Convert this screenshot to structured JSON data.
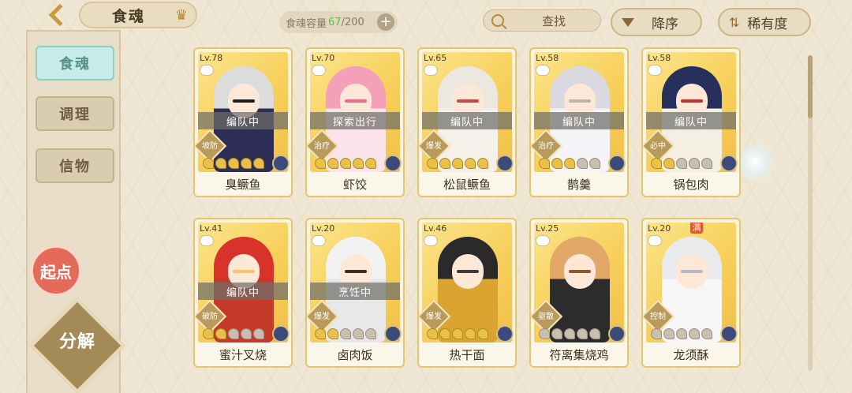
{
  "header": {
    "title": "食魂",
    "capacity_label": "食魂容量",
    "capacity_current": "67",
    "capacity_total": "/200",
    "capacity_plus": "+",
    "search_label": "查找",
    "sort_label": "降序",
    "rarity_label": "稀有度",
    "rarity_symbol": "⇅"
  },
  "sidebar": {
    "tabs": [
      {
        "label": "食魂"
      },
      {
        "label": "调理"
      },
      {
        "label": "信物"
      }
    ],
    "start_label": "起点",
    "decompose_label": "分解"
  },
  "cards": [
    {
      "lv": "Lv.78",
      "status": "编队中",
      "role": "坡防",
      "name": "臭鳜鱼",
      "stars": 5,
      "lit": 5,
      "hair": "#dcdcdc",
      "cloth": "#2d2d56",
      "accent": "#1c1c1c"
    },
    {
      "lv": "Lv.70",
      "status": "探索出行",
      "role": "治疗",
      "name": "虾饺",
      "stars": 5,
      "lit": 5,
      "hair": "#f4a0b8",
      "cloth": "#fbe3ea",
      "accent": "#e86b8a"
    },
    {
      "lv": "Lv.65",
      "status": "编队中",
      "role": "爆发",
      "name": "松鼠鳜鱼",
      "stars": 5,
      "lit": 5,
      "hair": "#ece8e0",
      "cloth": "#f5f1ea",
      "accent": "#c44a4a"
    },
    {
      "lv": "Lv.58",
      "status": "编队中",
      "role": "治疗",
      "name": "鹊羹",
      "stars": 5,
      "lit": 3,
      "hair": "#d9d9df",
      "cloth": "#f4f4f8",
      "accent": "#bdb6a0"
    },
    {
      "lv": "Lv.58",
      "status": "编队中",
      "role": "必中",
      "name": "锅包肉",
      "stars": 5,
      "lit": 2,
      "hair": "#26305a",
      "cloth": "#f4efe3",
      "accent": "#b8322a"
    },
    {
      "lv": "Lv.41",
      "status": "编队中",
      "role": "破防",
      "name": "蜜汁叉烧",
      "stars": 5,
      "lit": 2,
      "hair": "#d8332a",
      "cloth": "#c63a2a",
      "accent": "#f6c56a"
    },
    {
      "lv": "Lv.20",
      "status": "烹饪中",
      "role": "爆发",
      "name": "卤肉饭",
      "stars": 5,
      "lit": 2,
      "hair": "#f2f2f2",
      "cloth": "#e8e8e8",
      "accent": "#3a2a20"
    },
    {
      "lv": "Lv.46",
      "status": "",
      "role": "爆发",
      "name": "热干面",
      "stars": 5,
      "lit": 5,
      "hair": "#2a2a2a",
      "cloth": "#d9a530",
      "accent": "#3d3a36"
    },
    {
      "lv": "Lv.25",
      "status": "",
      "role": "驱散",
      "name": "符离集烧鸡",
      "stars": 5,
      "lit": 0,
      "hair": "#e1a868",
      "cloth": "#2c2c2c",
      "accent": "#8b5a2a"
    },
    {
      "lv": "Lv.20",
      "status": "",
      "role": "控制",
      "name": "龙须酥",
      "stars": 5,
      "lit": 0,
      "hair": "#eaeaea",
      "cloth": "#f6f6f6",
      "accent": "#b8b8c8",
      "full": "满"
    }
  ]
}
